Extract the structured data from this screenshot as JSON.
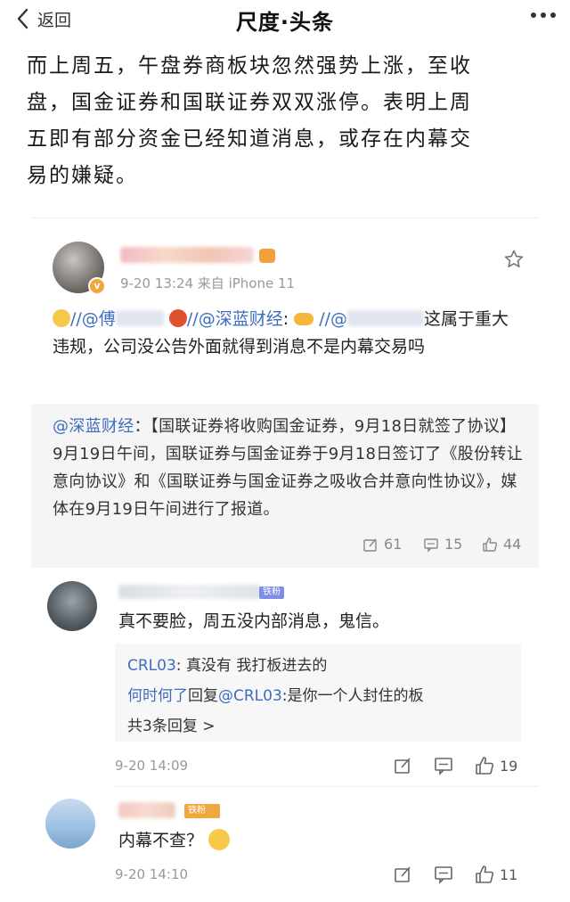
{
  "nav": {
    "back_label": "返回",
    "title": "尺度·头条"
  },
  "article": {
    "line1": "而上周五，午盘券商板块忽然强势上涨，至收",
    "line2": "盘，国金证券和国联证券双双涨停。表明上周",
    "line3": "五即有部分资金已经知道消息，或存在内幕交",
    "line4": "易的嫌疑。"
  },
  "post": {
    "meta": "9-20 13:24  来自 iPhone 11",
    "body_slash1": "//@",
    "body_name1": "傅",
    "body_slash2": "//",
    "body_mention": "@深蓝财经",
    "body_colon": ":",
    "body_slash3": "//@",
    "body_end": "这属于重大违规，公司没公告外面就得到消息不是内幕交易吗",
    "quote_mention": "@深蓝财经",
    "quote_text": "：【国联证券将收购国金证券，9月18日就签了协议】9月19日午间，国联证券与国金证券于9月18日签订了《股份转让意向协议》和《国联证券与国金证券之吸收合并意向性协议》，媒体在9月19日午间进行了报道。",
    "reposts": "61",
    "comments": "15",
    "likes": "44"
  },
  "comments": [
    {
      "badge": "铁粉",
      "text": "真不要脸，周五没内部消息，鬼信。",
      "replies": [
        {
          "user": "CRL03",
          "sep": ": ",
          "text": "真没有   我打板进去的"
        },
        {
          "user": "何时何了",
          "mid": "回复",
          "mention": "@CRL03",
          "sep": ":",
          "text": "是你一个人封住的板"
        }
      ],
      "more_replies": "共3条回复 >",
      "time": "9-20 14:09",
      "likes": "19"
    },
    {
      "badge": "铁粉",
      "text": "内幕不查？",
      "time": "9-20 14:10",
      "likes": "11"
    }
  ],
  "colors": {
    "link": "#3d6dbf",
    "quote_bg": "#f5f5f5",
    "meta": "#999999"
  },
  "icons": [
    "back-chevron-icon",
    "more-dots-icon",
    "star-icon",
    "repost-icon",
    "comment-icon",
    "like-icon"
  ]
}
